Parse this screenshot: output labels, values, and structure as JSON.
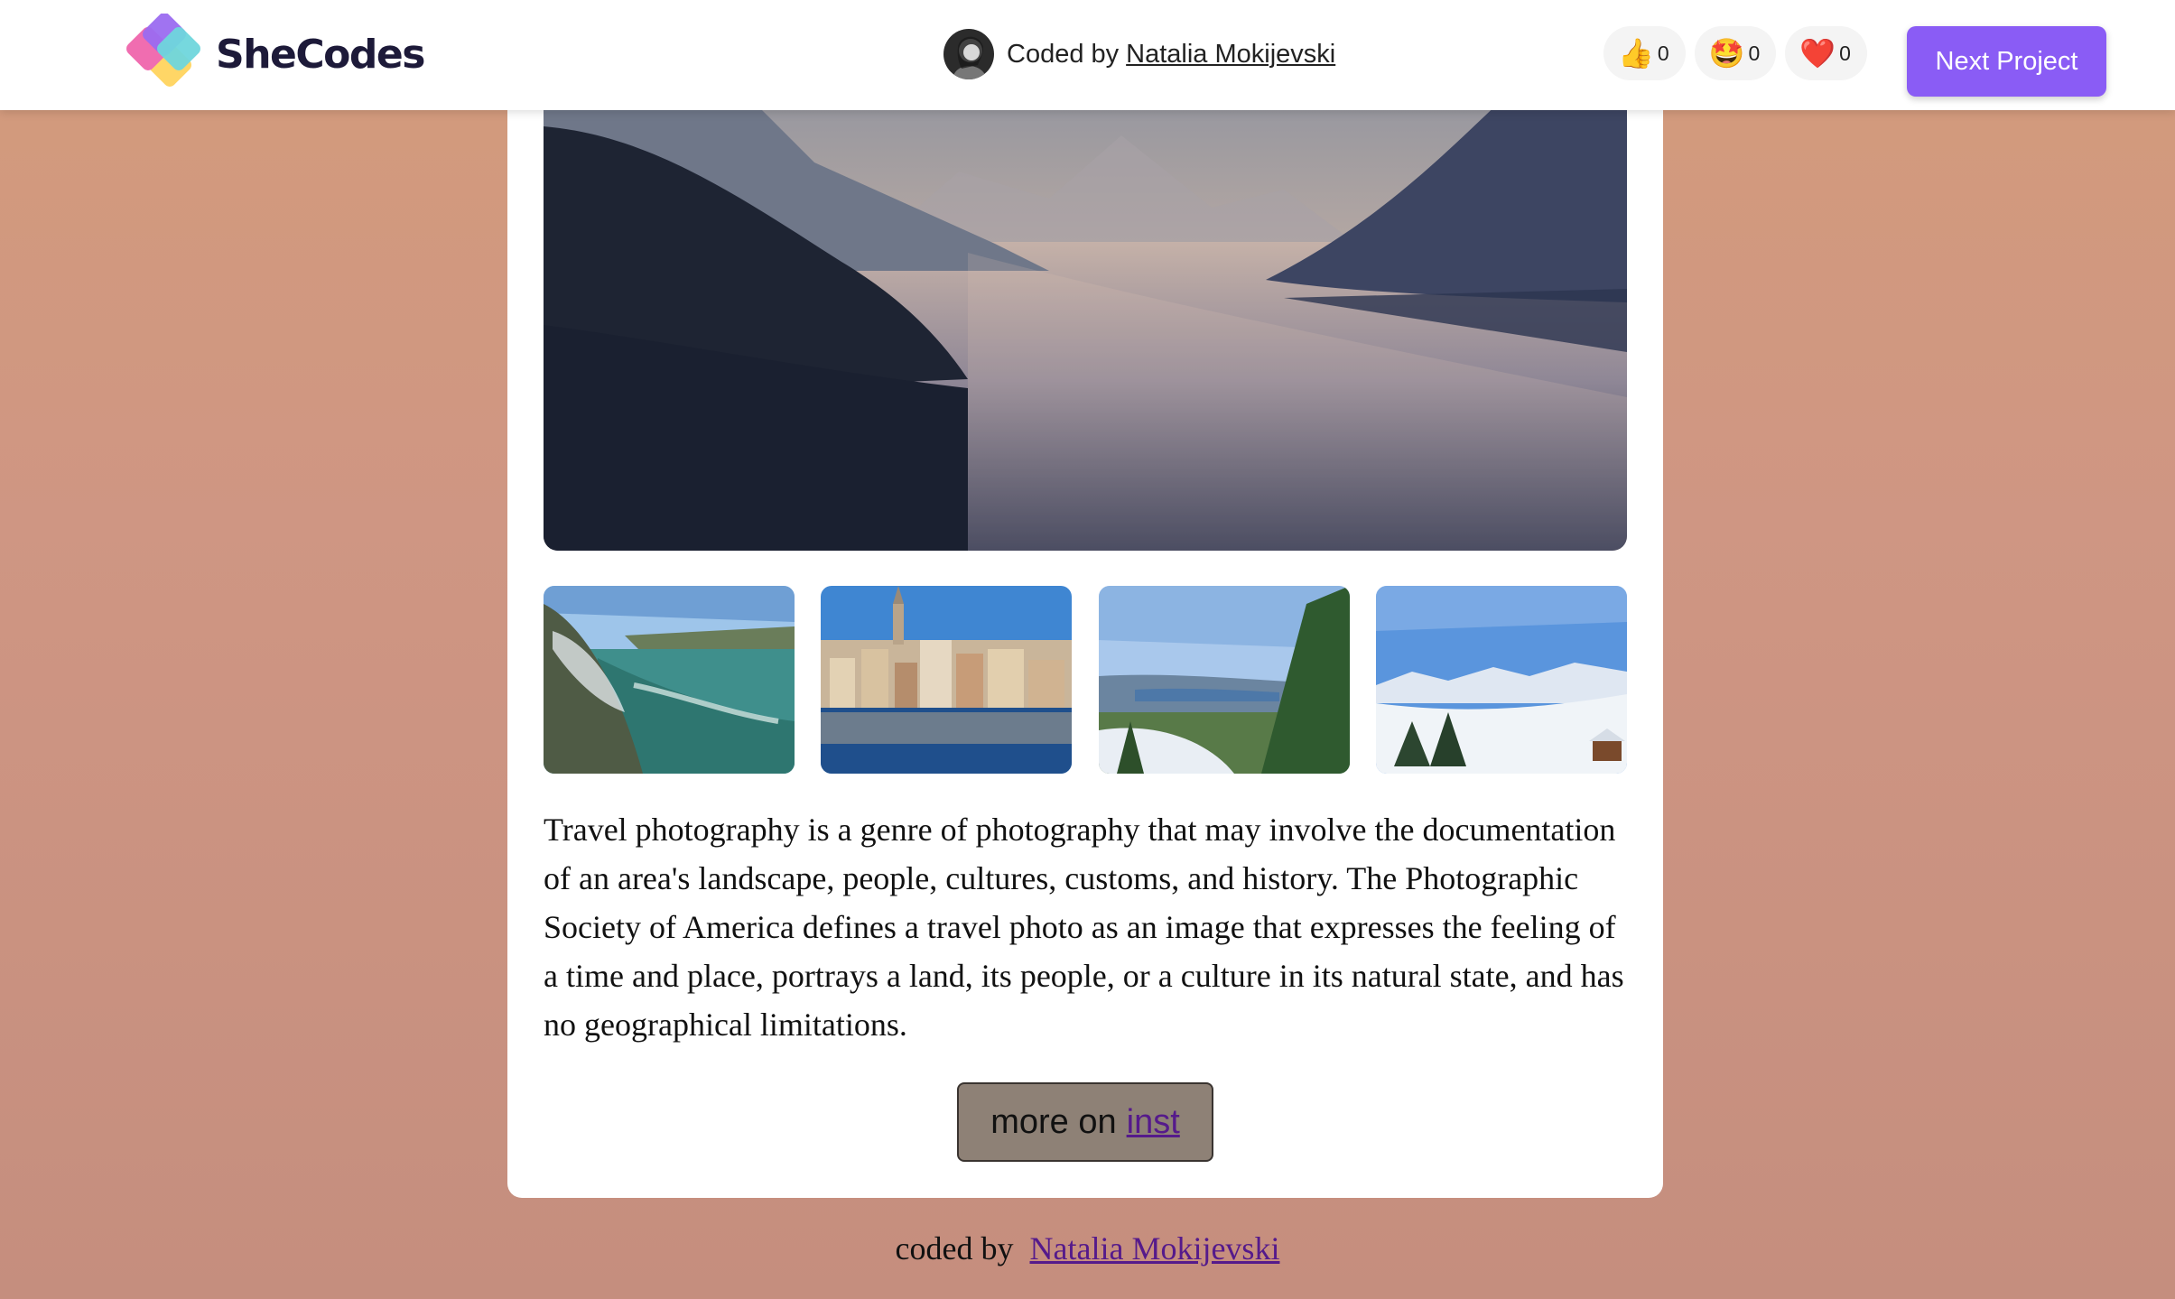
{
  "header": {
    "brand": "SheCodes",
    "coded_by_label": "Coded by",
    "author_name": "Natalia Mokijevski",
    "reactions": [
      {
        "emoji": "👍",
        "count": "0",
        "icon": "thumbs-up-icon"
      },
      {
        "emoji": "🤩",
        "count": "0",
        "icon": "star-struck-icon"
      },
      {
        "emoji": "❤️",
        "count": "0",
        "icon": "heart-icon"
      }
    ],
    "next_label": "Next Project",
    "accent": "#8a5cf5"
  },
  "main": {
    "hero_image": "lake-mountains-photo",
    "thumbnails": [
      "waterfall-photo",
      "city-waterfront-photo",
      "mountain-lake-view-photo",
      "snowy-alps-photo"
    ],
    "description": "Travel photography is a genre of photography that may involve the documentation of an area's landscape, people, cultures, customs, and history. The Photographic Society of America defines a travel photo as an image that expresses the feeling of a time and place, portrays a land, its people, or a culture in its natural state, and has no geographical limitations.",
    "more_prefix": "more on",
    "more_link": "inst"
  },
  "footer": {
    "prefix": "coded by",
    "author_link": "Natalia Mokijevski"
  },
  "colors": {
    "background": "#cf9683",
    "card": "#ffffff",
    "more_button": "#8e8176",
    "link_visited": "#551a8b"
  }
}
